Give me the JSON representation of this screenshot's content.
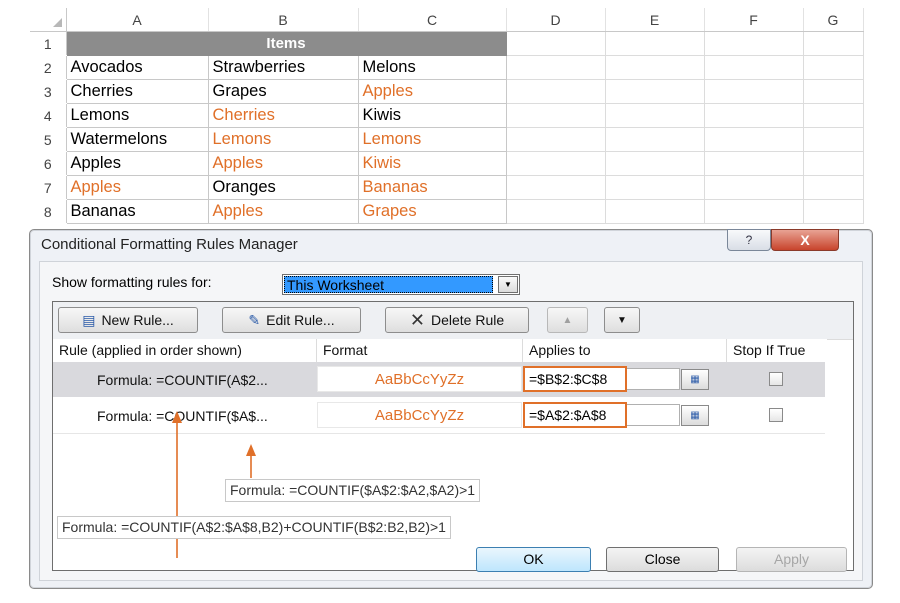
{
  "sheet": {
    "columns": [
      "A",
      "B",
      "C",
      "D",
      "E",
      "F",
      "G"
    ],
    "rows": [
      "1",
      "2",
      "3",
      "4",
      "5",
      "6",
      "7",
      "8"
    ],
    "header_text": "Items",
    "data": [
      [
        {
          "t": "Avocados",
          "hl": false
        },
        {
          "t": "Strawberries",
          "hl": false
        },
        {
          "t": "Melons",
          "hl": false
        }
      ],
      [
        {
          "t": "Cherries",
          "hl": false
        },
        {
          "t": "Grapes",
          "hl": false
        },
        {
          "t": "Apples",
          "hl": true
        }
      ],
      [
        {
          "t": "Lemons",
          "hl": false
        },
        {
          "t": "Cherries",
          "hl": true
        },
        {
          "t": "Kiwis",
          "hl": false
        }
      ],
      [
        {
          "t": "Watermelons",
          "hl": false
        },
        {
          "t": "Lemons",
          "hl": true
        },
        {
          "t": "Lemons",
          "hl": true
        }
      ],
      [
        {
          "t": "Apples",
          "hl": false
        },
        {
          "t": "Apples",
          "hl": true
        },
        {
          "t": "Kiwis",
          "hl": true
        }
      ],
      [
        {
          "t": "Apples",
          "hl": true
        },
        {
          "t": "Oranges",
          "hl": false
        },
        {
          "t": "Bananas",
          "hl": true
        }
      ],
      [
        {
          "t": "Bananas",
          "hl": false
        },
        {
          "t": "Apples",
          "hl": true
        },
        {
          "t": "Grapes",
          "hl": true
        }
      ]
    ],
    "highlight_color": "#e07029"
  },
  "dialog": {
    "title": "Conditional Formatting Rules Manager",
    "help_label": "?",
    "close_label": "X",
    "show_label": "Show formatting rules for:",
    "show_value": "This Worksheet",
    "buttons": {
      "new_rule": "New Rule...",
      "edit_rule": "Edit Rule...",
      "delete_rule": "Delete Rule",
      "move_up": "▲",
      "move_down": "▼"
    },
    "columns": {
      "rule": "Rule (applied in order shown)",
      "format": "Format",
      "applies_to": "Applies to",
      "stop_if_true": "Stop If True"
    },
    "rules": [
      {
        "rule": "Formula: =COUNTIF(A$2...",
        "format_preview": "AaBbCcYyZz",
        "applies_to": "=$B$2:$C$8",
        "stop_if_true": false
      },
      {
        "rule": "Formula: =COUNTIF($A$...",
        "format_preview": "AaBbCcYyZz",
        "applies_to": "=$A$2:$A$8",
        "stop_if_true": false
      }
    ],
    "callouts": {
      "second": "Formula: =COUNTIF($A$2:$A2,$A2)>1",
      "first": "Formula: =COUNTIF(A$2:$A$8,B2)+COUNTIF(B$2:B2,B2)>1"
    },
    "footer": {
      "ok": "OK",
      "close": "Close",
      "apply": "Apply"
    },
    "accent": "#e07029"
  }
}
